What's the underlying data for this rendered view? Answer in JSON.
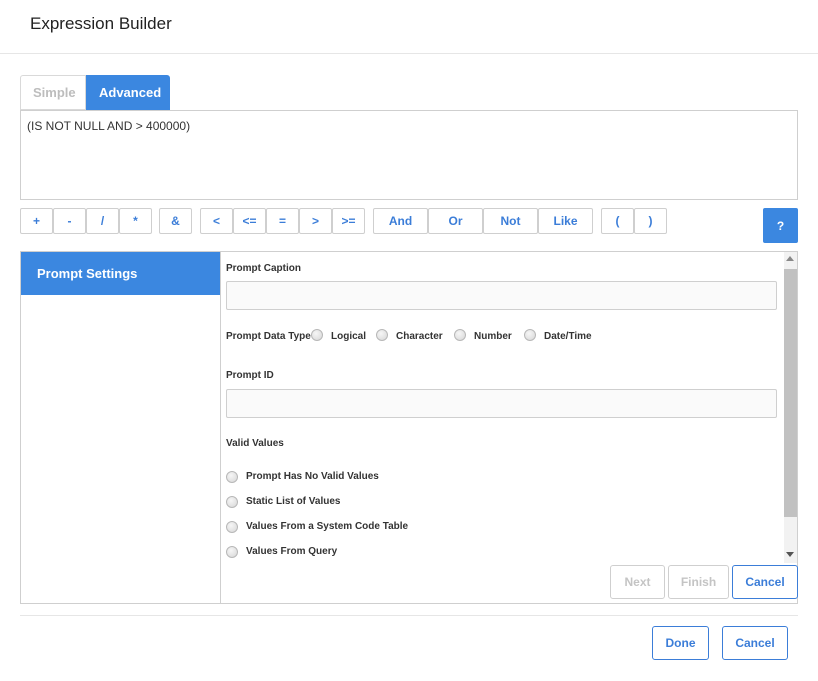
{
  "dialog": {
    "title": "Expression Builder"
  },
  "mode_tabs": {
    "simple": "Simple",
    "advanced": "Advanced",
    "selected": "Advanced"
  },
  "expression": {
    "value": "(IS NOT NULL AND > 400000)"
  },
  "operators": {
    "arithmetic": [
      "+",
      "-",
      "/",
      "*"
    ],
    "concat": "&",
    "comparison": [
      "<",
      "<=",
      "=",
      ">",
      ">="
    ],
    "logical": [
      "And",
      "Or",
      "Not",
      "Like"
    ],
    "parens": [
      "(",
      ")"
    ],
    "help": "?"
  },
  "left_nav": {
    "active_item": "Prompt Settings"
  },
  "prompt": {
    "caption_label": "Prompt Caption",
    "caption_value": "",
    "data_type_label": "Prompt Data Type",
    "data_types": [
      "Logical",
      "Character",
      "Number",
      "Date/Time"
    ],
    "id_label": "Prompt ID",
    "id_value": "",
    "valid_values_label": "Valid Values",
    "valid_values_options": [
      "Prompt Has No Valid Values",
      "Static List of Values",
      "Values From a System Code Table",
      "Values From Query"
    ]
  },
  "wizard_buttons": {
    "next": "Next",
    "finish": "Finish",
    "cancel": "Cancel"
  },
  "footer_buttons": {
    "done": "Done",
    "cancel": "Cancel"
  },
  "colors": {
    "accent": "#3b87e0",
    "link": "#3b7dd8",
    "border": "#cfcfcf",
    "disabled": "#c4c4c4"
  },
  "icons": {
    "globe": "globe-icon",
    "scroll_up": "chevron-up-icon",
    "scroll_down": "chevron-down-icon"
  }
}
